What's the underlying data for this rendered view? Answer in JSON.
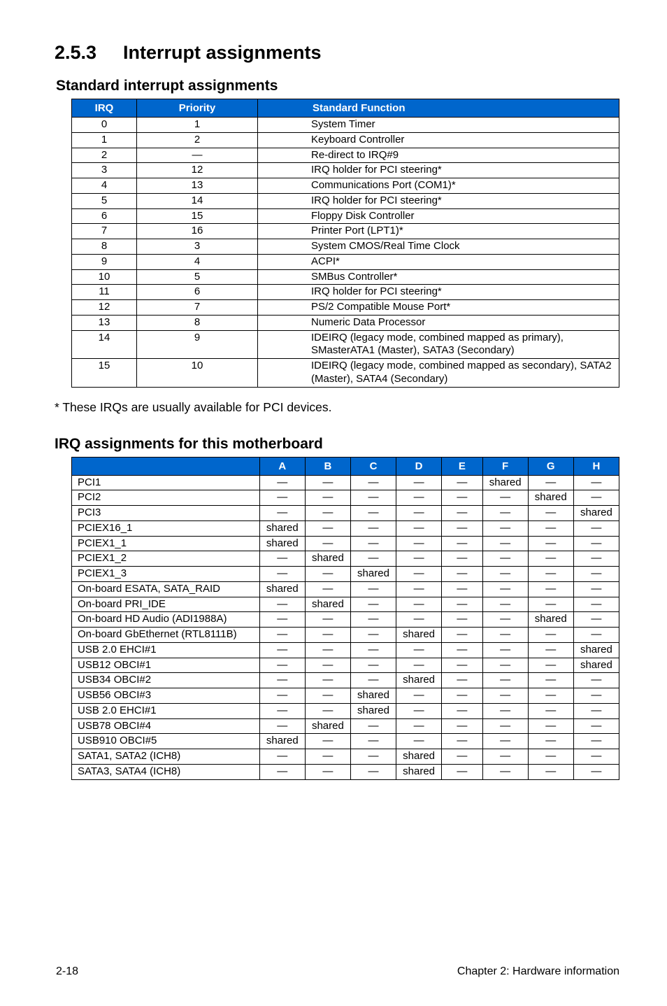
{
  "heading": {
    "number": "2.5.3",
    "title": "Interrupt assignments"
  },
  "table1": {
    "title": "Standard interrupt assignments",
    "headers": {
      "irq": "IRQ",
      "priority": "Priority",
      "fn": "Standard Function"
    },
    "rows": [
      {
        "irq": "0",
        "priority": "1",
        "fn": "System Timer"
      },
      {
        "irq": "1",
        "priority": "2",
        "fn": "Keyboard Controller"
      },
      {
        "irq": "2",
        "priority": "—",
        "fn": "Re-direct to IRQ#9"
      },
      {
        "irq": "3",
        "priority": "12",
        "fn": "IRQ holder for PCI steering*"
      },
      {
        "irq": "4",
        "priority": "13",
        "fn": "Communications Port (COM1)*"
      },
      {
        "irq": "5",
        "priority": "14",
        "fn": "IRQ holder for PCI steering*"
      },
      {
        "irq": "6",
        "priority": "15",
        "fn": "Floppy Disk Controller"
      },
      {
        "irq": "7",
        "priority": "16",
        "fn": "Printer Port (LPT1)*"
      },
      {
        "irq": "8",
        "priority": "3",
        "fn": "System CMOS/Real Time Clock"
      },
      {
        "irq": "9",
        "priority": "4",
        "fn": "ACPI*"
      },
      {
        "irq": "10",
        "priority": "5",
        "fn": "SMBus Controller*"
      },
      {
        "irq": "11",
        "priority": "6",
        "fn": "IRQ holder for PCI steering*"
      },
      {
        "irq": "12",
        "priority": "7",
        "fn": "PS/2 Compatible Mouse Port*"
      },
      {
        "irq": "13",
        "priority": "8",
        "fn": "Numeric Data Processor"
      },
      {
        "irq": "14",
        "priority": "9",
        "fn": "IDEIRQ (legacy mode, combined mapped as primary), SMasterATA1 (Master), SATA3 (Secondary)"
      },
      {
        "irq": "15",
        "priority": "10",
        "fn": "IDEIRQ (legacy mode, combined mapped as secondary), SATA2 (Master), SATA4 (Secondary)"
      }
    ]
  },
  "note": "* These IRQs are usually available for PCI devices.",
  "table2": {
    "title": "IRQ assignments for this motherboard",
    "cols": [
      "A",
      "B",
      "C",
      "D",
      "E",
      "F",
      "G",
      "H"
    ],
    "rows": [
      {
        "name": "PCI1",
        "cells": [
          "—",
          "—",
          "—",
          "—",
          "—",
          "shared",
          "—",
          "—"
        ]
      },
      {
        "name": "PCI2",
        "cells": [
          "—",
          "—",
          "—",
          "—",
          "—",
          "—",
          "shared",
          "—"
        ]
      },
      {
        "name": "PCI3",
        "cells": [
          "—",
          "—",
          "—",
          "—",
          "—",
          "—",
          "—",
          "shared"
        ]
      },
      {
        "name": "PCIEX16_1",
        "cells": [
          "shared",
          "—",
          "—",
          "—",
          "—",
          "—",
          "—",
          "—"
        ]
      },
      {
        "name": "PCIEX1_1",
        "cells": [
          "shared",
          "—",
          "—",
          "—",
          "—",
          "—",
          "—",
          "—"
        ]
      },
      {
        "name": "PCIEX1_2",
        "cells": [
          "—",
          "shared",
          "—",
          "—",
          "—",
          "—",
          "—",
          "—"
        ]
      },
      {
        "name": "PCIEX1_3",
        "cells": [
          "—",
          "—",
          "shared",
          "—",
          "—",
          "—",
          "—",
          "—"
        ]
      },
      {
        "name": "On-board ESATA, SATA_RAID",
        "cells": [
          "shared",
          "—",
          "—",
          "—",
          "—",
          "—",
          "—",
          "—"
        ]
      },
      {
        "name": "On-board PRI_IDE",
        "cells": [
          "—",
          "shared",
          "—",
          "—",
          "—",
          "—",
          "—",
          "—"
        ]
      },
      {
        "name": "On-board HD Audio (ADI1988A)",
        "cells": [
          "—",
          "—",
          "—",
          "—",
          "—",
          "—",
          "shared",
          "—"
        ]
      },
      {
        "name": "On-board GbEthernet (RTL8111B)",
        "cells": [
          "—",
          "—",
          "—",
          "shared",
          "—",
          "—",
          "—",
          "—"
        ]
      },
      {
        "name": "USB 2.0 EHCI#1",
        "cells": [
          "—",
          "—",
          "—",
          "—",
          "—",
          "—",
          "—",
          "shared"
        ]
      },
      {
        "name": "USB12 OBCI#1",
        "cells": [
          "—",
          "—",
          "—",
          "—",
          "—",
          "—",
          "—",
          "shared"
        ]
      },
      {
        "name": "USB34 OBCI#2",
        "cells": [
          "—",
          "—",
          "—",
          "shared",
          "—",
          "—",
          "—",
          "—"
        ]
      },
      {
        "name": "USB56 OBCI#3",
        "cells": [
          "—",
          "—",
          "shared",
          "—",
          "—",
          "—",
          "—",
          "—"
        ]
      },
      {
        "name": "USB 2.0 EHCI#1",
        "cells": [
          "—",
          "—",
          "shared",
          "—",
          "—",
          "—",
          "—",
          "—"
        ]
      },
      {
        "name": "USB78 OBCI#4",
        "cells": [
          "—",
          "shared",
          "—",
          "—",
          "—",
          "—",
          "—",
          "—"
        ]
      },
      {
        "name": "USB910 OBCI#5",
        "cells": [
          "shared",
          "—",
          "—",
          "—",
          "—",
          "—",
          "—",
          "—"
        ]
      },
      {
        "name": "SATA1, SATA2 (ICH8)",
        "cells": [
          "—",
          "—",
          "—",
          "shared",
          "—",
          "—",
          "—",
          "—"
        ]
      },
      {
        "name": "SATA3, SATA4 (ICH8)",
        "cells": [
          "—",
          "—",
          "—",
          "shared",
          "—",
          "—",
          "—",
          "—"
        ]
      }
    ]
  },
  "footer": {
    "left": "2-18",
    "right": "Chapter 2: Hardware information"
  }
}
